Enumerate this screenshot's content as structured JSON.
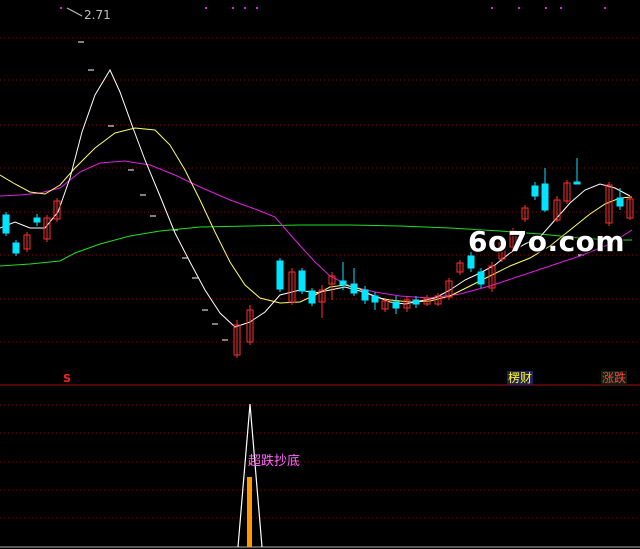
{
  "main_chart": {
    "price_label": "2.71",
    "buy_marker": "S",
    "tag_fortune": "楞财",
    "tag_updown": "涨跌"
  },
  "indicator": {
    "signal_label": "超跌抄底"
  },
  "watermark": "6o7o.com",
  "colors": {
    "background": "#000000",
    "bull_candle": "#ff3030",
    "bear_candle": "#00e5ff",
    "line_white": "#ffffff",
    "line_yellow": "#ffff66",
    "line_magenta": "#e020e0",
    "line_green": "#20e020",
    "signal_bar": "#ff9900"
  }
}
